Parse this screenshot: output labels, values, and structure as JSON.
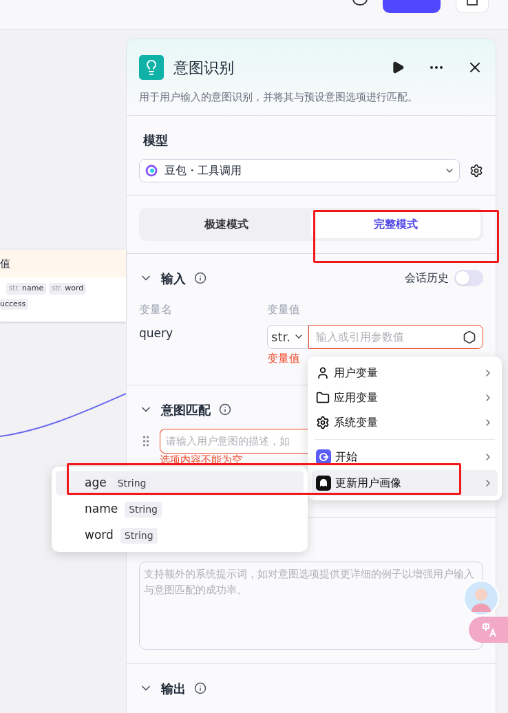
{
  "canvas_node": {
    "title": "值",
    "tags": [
      {
        "type": "str.",
        "name": "name"
      },
      {
        "type": "str.",
        "name": "word"
      }
    ],
    "cut_tag": "uccess"
  },
  "panel": {
    "title": "意图识别",
    "description": "用于用户输入的意图识别，并将其与预设意图选项进行匹配。",
    "model": {
      "label": "模型",
      "value": "豆包・工具调用"
    },
    "modes": [
      {
        "label": "极速模式",
        "selected": false
      },
      {
        "label": "完整模式",
        "selected": true
      }
    ],
    "input": {
      "title": "输入",
      "history_label": "会话历史",
      "history_on": false,
      "columns": [
        "变量名",
        "变量值"
      ],
      "rows": [
        {
          "name": "query",
          "type": "str.",
          "placeholder": "输入或引用参数值",
          "error": "变量值"
        }
      ]
    },
    "intent": {
      "title": "意图匹配",
      "options": [
        {
          "placeholder": "请输入用户意图的描述，如",
          "error": "选项内容不能为空"
        }
      ]
    },
    "system_prompt": {
      "placeholder": "支持额外的系统提示词，如对意图选项提供更详细的例子以增强用户输入与意图匹配的成功率。"
    },
    "output": {
      "title": "输出"
    }
  },
  "variable_menu": {
    "items": [
      {
        "label": "用户变量",
        "kind": "user",
        "selected": false
      },
      {
        "label": "应用变量",
        "kind": "app",
        "selected": false
      },
      {
        "label": "系统变量",
        "kind": "system",
        "selected": false
      },
      {
        "label": "开始",
        "kind": "start",
        "selected": false
      },
      {
        "label": "更新用户画像",
        "kind": "node",
        "selected": true
      }
    ]
  },
  "field_menu": {
    "items": [
      {
        "name": "age",
        "type": "String",
        "selected": true
      },
      {
        "name": "name",
        "type": "String",
        "selected": false
      },
      {
        "name": "word",
        "type": "String",
        "selected": false
      }
    ]
  }
}
